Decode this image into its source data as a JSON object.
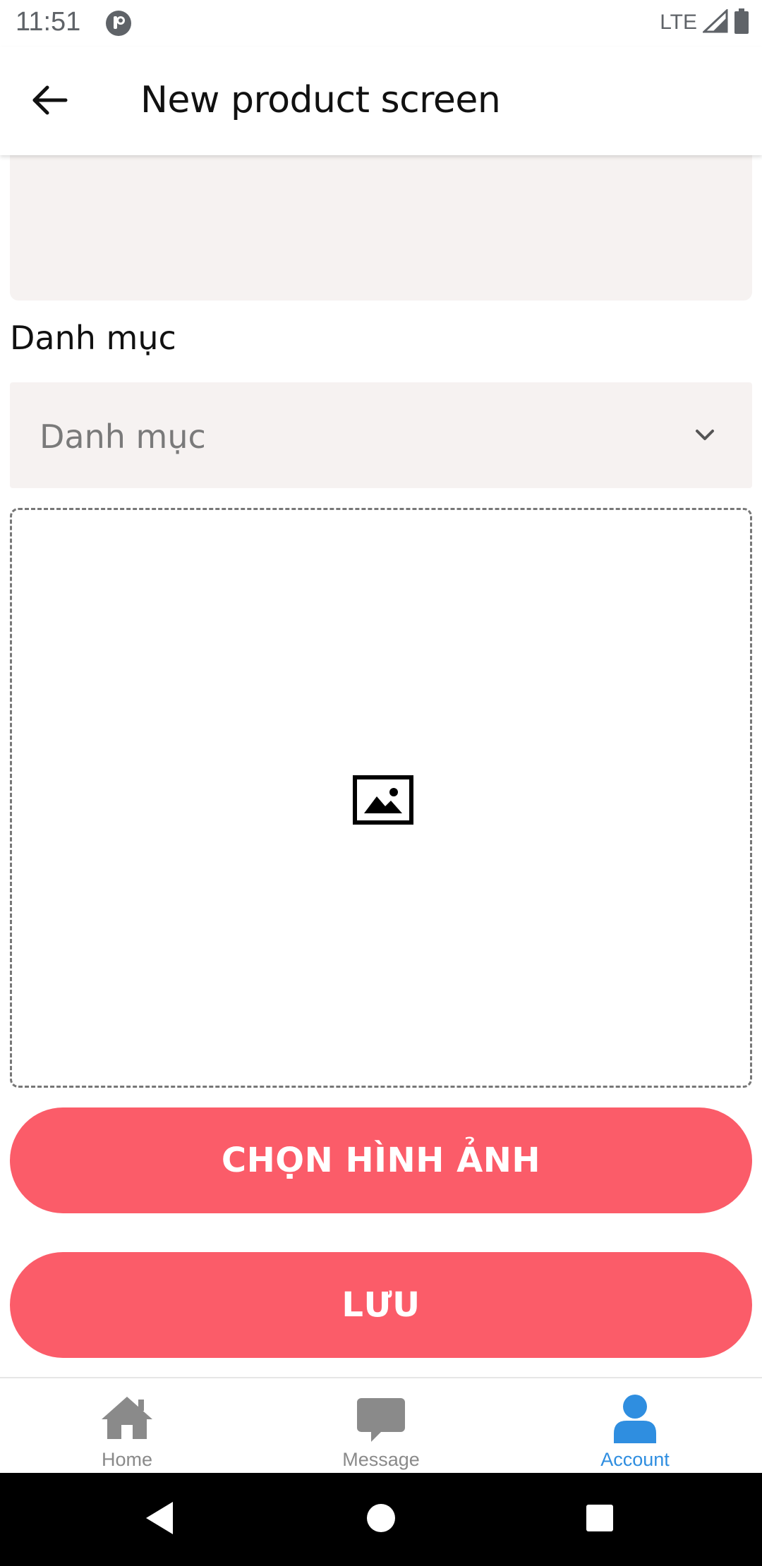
{
  "status_bar": {
    "time": "11:51",
    "network": "LTE",
    "icons": [
      "app-notification-icon",
      "signal-icon",
      "battery-icon"
    ]
  },
  "app_bar": {
    "title": "New product screen",
    "back_icon": "arrow-left-icon"
  },
  "form": {
    "category_label": "Danh mục",
    "category_select": {
      "placeholder": "Danh mục",
      "icon": "chevron-down-icon"
    },
    "image_placeholder_icon": "image-icon",
    "choose_image_button": "CHỌN HÌNH ẢNH",
    "save_button": "LƯU"
  },
  "bottom_nav": {
    "items": [
      {
        "label": "Home",
        "icon": "home-icon",
        "active": false
      },
      {
        "label": "Message",
        "icon": "message-icon",
        "active": false
      },
      {
        "label": "Account",
        "icon": "user-icon",
        "active": true
      }
    ]
  },
  "colors": {
    "accent": "#fb5c69",
    "active_nav": "#2f8ee0",
    "inactive_nav": "#8a8a8a",
    "field_background": "#f6f2f1"
  }
}
